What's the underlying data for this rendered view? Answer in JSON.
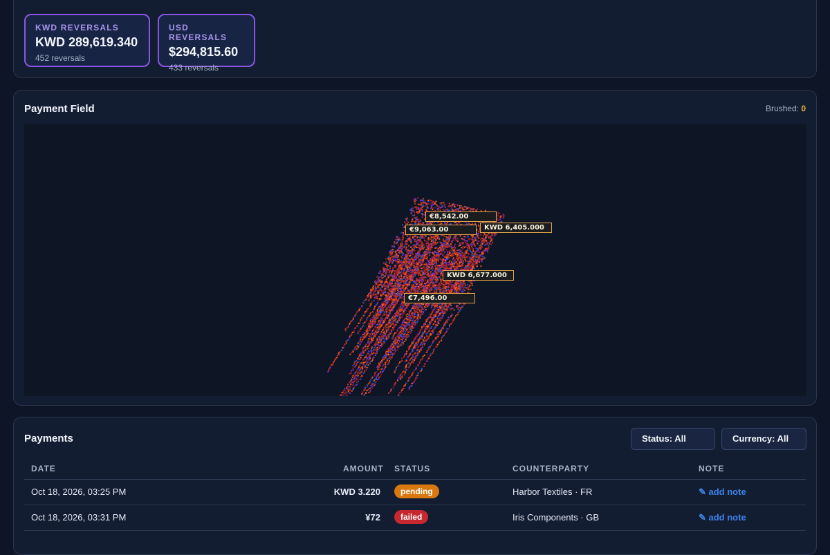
{
  "summary": {
    "cards": [
      {
        "label": "KWD REVERSALS",
        "value": "KWD 289,619.340",
        "sub": "452 reversals"
      },
      {
        "label": "USD REVERSALS",
        "value": "$294,815.60",
        "sub": "433 reversals"
      }
    ]
  },
  "field": {
    "title": "Payment Field",
    "brushed_label": "Brushed:",
    "brushed_count": "0",
    "tooltips": [
      "€8,542.00",
      "€9,063.00",
      "KWD 6,405.000",
      "KWD 6,677.000",
      "€7,496.00"
    ],
    "colors": [
      "#c0272d",
      "#8a1c2a",
      "#d84a16",
      "#7b2fd0",
      "#2e4fc0",
      "#c23b1c",
      "#a81f3a",
      "#ff5a22"
    ]
  },
  "payments": {
    "title": "Payments",
    "status_filter": "Status: All",
    "currency_filter": "Currency: All",
    "columns": {
      "date": "DATE",
      "amount": "AMOUNT",
      "status": "STATUS",
      "counterparty": "COUNTERPARTY",
      "note": "NOTE"
    },
    "rows": [
      {
        "date": "Oct 18, 2026, 03:25 PM",
        "amount": "KWD 3.220",
        "status": "pending",
        "counterparty": "Harbor Textiles · FR",
        "note": "✎ add note"
      },
      {
        "date": "Oct 18, 2026, 03:31 PM",
        "amount": "¥72",
        "status": "failed",
        "counterparty": "Iris Components · GB",
        "note": "✎ add note"
      }
    ]
  }
}
